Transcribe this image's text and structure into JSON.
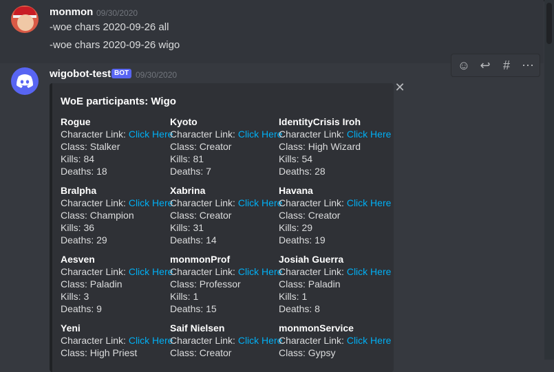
{
  "messages": [
    {
      "username": "monmon",
      "timestamp": "09/30/2020",
      "lines": [
        "-woe chars 2020-09-26 all",
        "-woe chars 2020-09-26 wigo"
      ]
    },
    {
      "username": "wigobot-test",
      "badge": "BOT",
      "timestamp": "09/30/2020",
      "embed": {
        "title": "WoE participants: Wigo",
        "link_prefix": "Character Link:",
        "link_text": "Click Here",
        "participants": [
          {
            "name": "Rogue",
            "class": "Class: Stalker",
            "kills": "Kills: 84",
            "deaths": "Deaths: 18"
          },
          {
            "name": "Kyoto",
            "class": "Class: Creator",
            "kills": "Kills: 81",
            "deaths": "Deaths: 7"
          },
          {
            "name": "IdentityCrisis Iroh",
            "class": "Class: High Wizard",
            "kills": "Kills: 54",
            "deaths": "Deaths: 28"
          },
          {
            "name": "Bralpha",
            "class": "Class: Champion",
            "kills": "Kills: 36",
            "deaths": "Deaths: 29"
          },
          {
            "name": "Xabrina",
            "class": "Class: Creator",
            "kills": "Kills: 31",
            "deaths": "Deaths: 14"
          },
          {
            "name": "Havana",
            "class": "Class: Creator",
            "kills": "Kills: 29",
            "deaths": "Deaths: 19"
          },
          {
            "name": "Aesven",
            "class": "Class: Paladin",
            "kills": "Kills: 3",
            "deaths": "Deaths: 9"
          },
          {
            "name": "monmonProf",
            "class": "Class: Professor",
            "kills": "Kills: 1",
            "deaths": "Deaths: 15"
          },
          {
            "name": "Josiah Guerra",
            "class": "Class: Paladin",
            "kills": "Kills: 1",
            "deaths": "Deaths: 8"
          },
          {
            "name": "Yeni",
            "class": "Class: High Priest",
            "kills": "",
            "deaths": ""
          },
          {
            "name": "Saif Nielsen",
            "class": "Class: Creator",
            "kills": "",
            "deaths": ""
          },
          {
            "name": "monmonService",
            "class": "Class: Gypsy",
            "kills": "",
            "deaths": ""
          }
        ]
      }
    }
  ],
  "actions": [
    "add-reaction-icon",
    "reply-icon",
    "create-thread-icon",
    "more-icon"
  ],
  "colors": {
    "background": "#36393f",
    "embed": "#2f3136",
    "link": "#00aff4",
    "blurple": "#5865f2"
  }
}
